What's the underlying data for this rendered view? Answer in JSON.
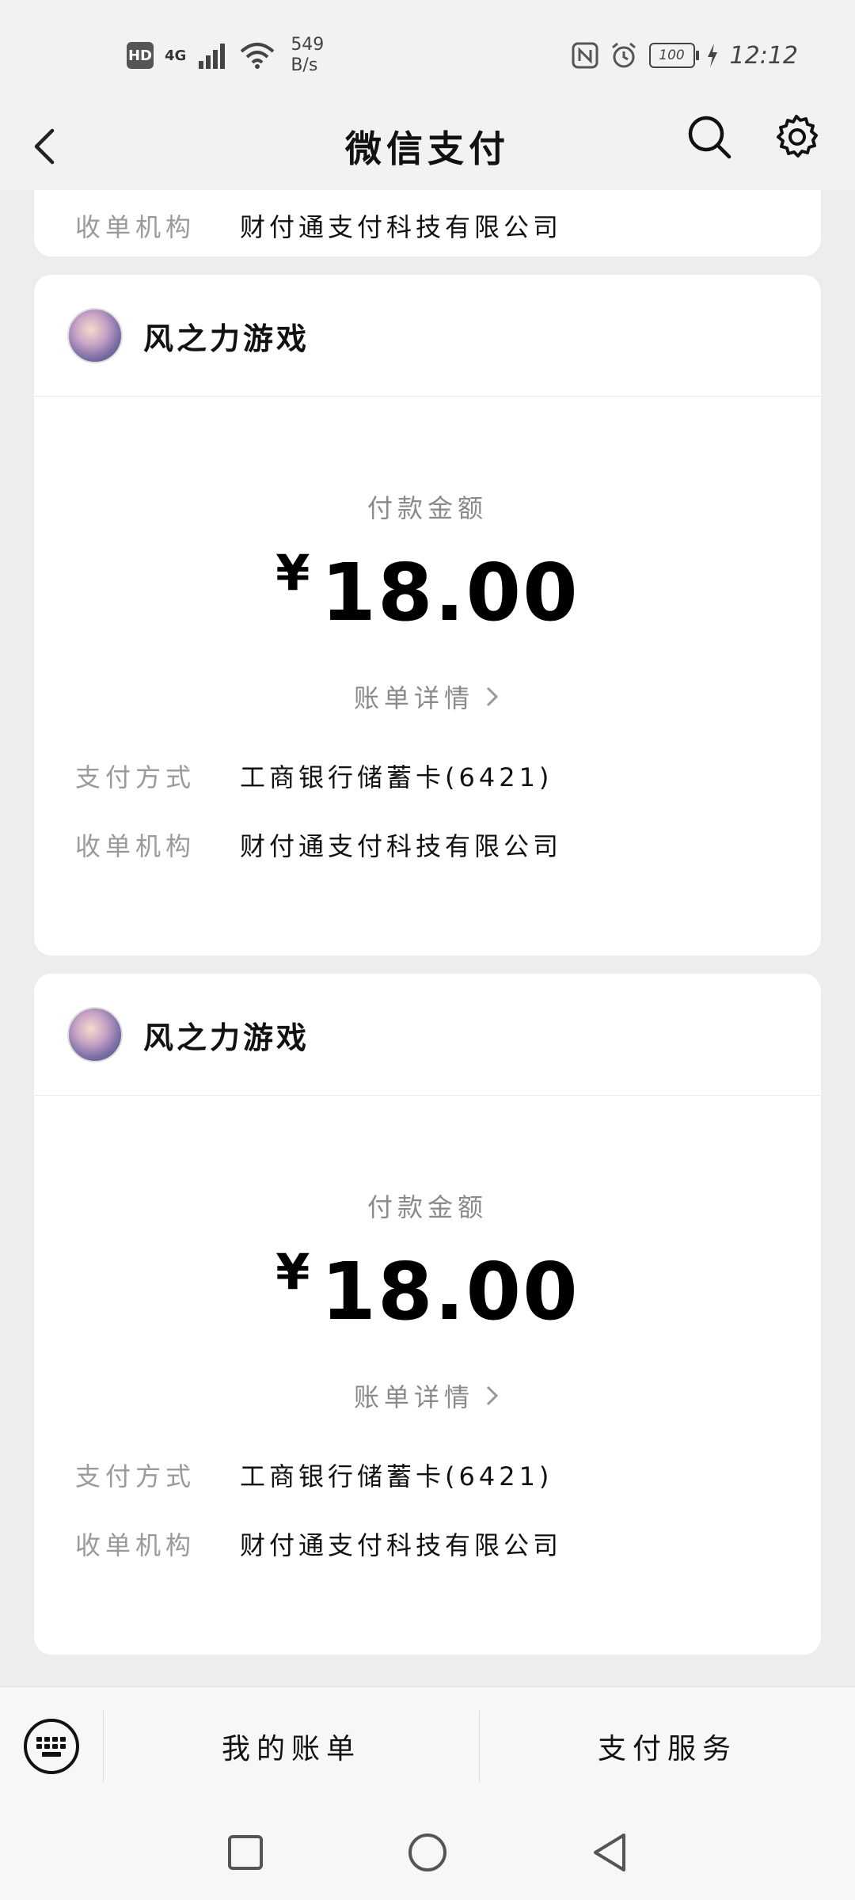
{
  "status_bar": {
    "hd": "HD",
    "network": "4G",
    "speed_value": "549",
    "speed_unit": "B/s",
    "battery": "100",
    "time": "12:12"
  },
  "nav": {
    "title": "微信支付",
    "back_icon": "chevron-left-icon",
    "search_icon": "search-icon",
    "settings_icon": "gear-icon"
  },
  "partial_card": {
    "label": "收单机构",
    "value": "财付通支付科技有限公司"
  },
  "records": [
    {
      "merchant": "风之力游戏",
      "amount_label": "付款金额",
      "currency": "¥",
      "amount": "18.00",
      "detail_link": "账单详情",
      "rows": [
        {
          "label": "支付方式",
          "value": "工商银行储蓄卡(6421)"
        },
        {
          "label": "收单机构",
          "value": "财付通支付科技有限公司"
        }
      ]
    },
    {
      "merchant": "风之力游戏",
      "amount_label": "付款金额",
      "currency": "¥",
      "amount": "18.00",
      "detail_link": "账单详情",
      "rows": [
        {
          "label": "支付方式",
          "value": "工商银行储蓄卡(6421)"
        },
        {
          "label": "收单机构",
          "value": "财付通支付科技有限公司"
        }
      ]
    }
  ],
  "tab_bar": {
    "keyboard_icon": "keyboard-icon",
    "tab_bills": "我的账单",
    "tab_services": "支付服务"
  },
  "colors": {
    "background": "#ededed",
    "card": "#ffffff",
    "label_gray": "#9a9a9a",
    "text": "#111111"
  }
}
